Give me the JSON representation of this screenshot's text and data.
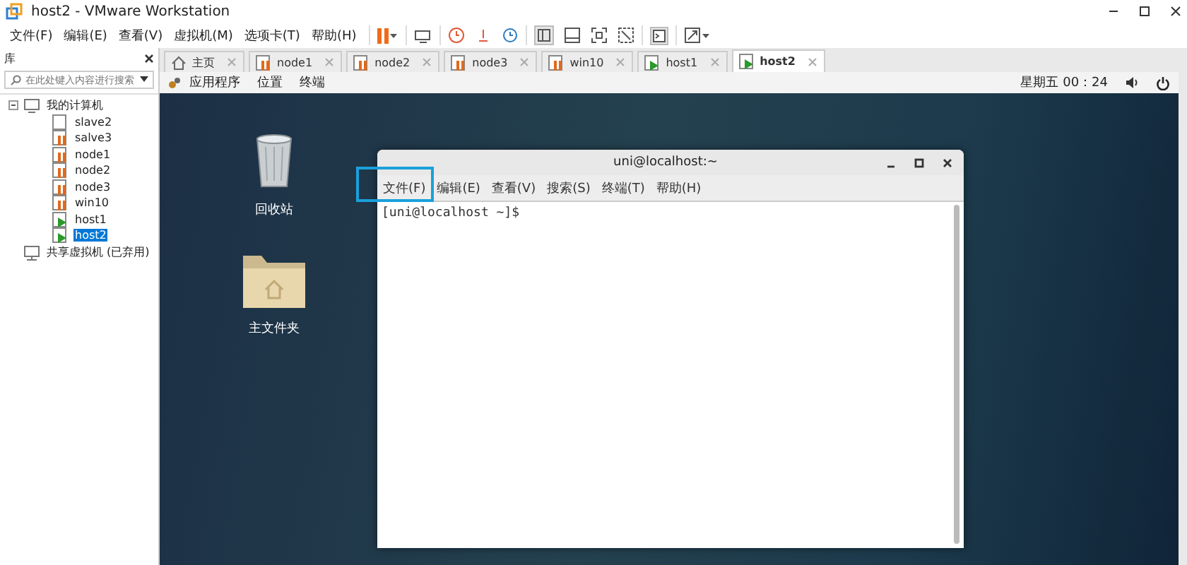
{
  "window": {
    "title": "host2 - VMware Workstation"
  },
  "menu": [
    "文件(F)",
    "编辑(E)",
    "查看(V)",
    "虚拟机(M)",
    "选项卡(T)",
    "帮助(H)"
  ],
  "library": {
    "title": "库",
    "search": {
      "placeholder": "在此处键入内容进行搜索"
    },
    "tree": [
      {
        "label": "我的计算机",
        "kind": "computer",
        "expanded": true,
        "selected": false,
        "children": [
          {
            "label": "slave2",
            "kind": "off",
            "selected": false
          },
          {
            "label": "salve3",
            "kind": "suspended",
            "selected": false
          },
          {
            "label": "node1",
            "kind": "suspended",
            "selected": false
          },
          {
            "label": "node2",
            "kind": "suspended",
            "selected": false
          },
          {
            "label": "node3",
            "kind": "suspended",
            "selected": false
          },
          {
            "label": "win10",
            "kind": "suspended",
            "selected": false
          },
          {
            "label": "host1",
            "kind": "running",
            "selected": false
          },
          {
            "label": "host2",
            "kind": "running",
            "selected": true
          }
        ]
      },
      {
        "label": "共享虚拟机 (已弃用)",
        "kind": "shared",
        "selected": false
      }
    ]
  },
  "tabs": [
    {
      "label": "主页",
      "kind": "home",
      "selected": false
    },
    {
      "label": "node1",
      "kind": "suspended",
      "selected": false
    },
    {
      "label": "node2",
      "kind": "suspended",
      "selected": false
    },
    {
      "label": "node3",
      "kind": "suspended",
      "selected": false
    },
    {
      "label": "win10",
      "kind": "suspended",
      "selected": false
    },
    {
      "label": "host1",
      "kind": "running",
      "selected": false
    },
    {
      "label": "host2",
      "kind": "running",
      "selected": true
    }
  ],
  "guest": {
    "top_bar": {
      "menus": [
        "应用程序",
        "位置",
        "终端"
      ],
      "clock": "星期五 00：24"
    },
    "desktop_icons": [
      {
        "label": "回收站",
        "kind": "trash"
      },
      {
        "label": "主文件夹",
        "kind": "home-folder"
      }
    ],
    "terminal": {
      "title": "uni@localhost:~",
      "menu": [
        "文件(F)",
        "编辑(E)",
        "查看(V)",
        "搜索(S)",
        "终端(T)",
        "帮助(H)"
      ],
      "prompt": "[uni@localhost ~]$"
    }
  }
}
